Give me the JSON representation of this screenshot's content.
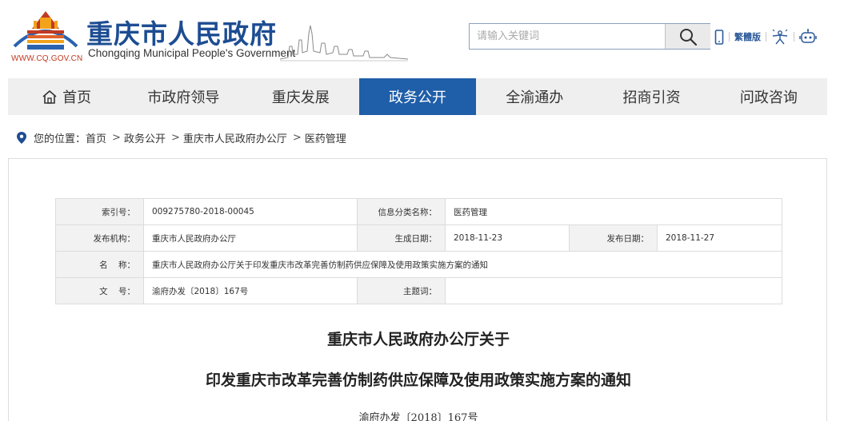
{
  "header": {
    "site_title": "重庆市人民政府",
    "site_subtitle": "Chongqing Municipal People's Government",
    "logo_url_text": "WWW.CQ.GOV.CN",
    "search": {
      "placeholder": "请输入关键词",
      "value": ""
    },
    "tools": {
      "mobile_icon": "mobile-icon",
      "traditional_label": "繁體版",
      "accessibility_icon": "accessibility-icon",
      "robot_icon": "robot-icon"
    }
  },
  "nav": {
    "items": [
      {
        "label": "首页",
        "icon": "home-icon",
        "active": false
      },
      {
        "label": "市政府领导",
        "active": false
      },
      {
        "label": "重庆发展",
        "active": false
      },
      {
        "label": "政务公开",
        "active": true
      },
      {
        "label": "全渝通办",
        "active": false
      },
      {
        "label": "招商引资",
        "active": false
      },
      {
        "label": "问政咨询",
        "active": false
      }
    ]
  },
  "breadcrumb": {
    "prefix": "您的位置：",
    "items": [
      "首页",
      "政务公开",
      "重庆市人民政府办公厅",
      "医药管理"
    ],
    "separator": ">"
  },
  "meta": {
    "index_no_label": "索引号：",
    "index_no": "009275780-2018-00045",
    "category_label": "信息分类名称：",
    "category": "医药管理",
    "publisher_label": "发布机构：",
    "publisher": "重庆市人民政府办公厅",
    "created_label": "生成日期：",
    "created": "2018-11-23",
    "published_label": "发布日期：",
    "published": "2018-11-27",
    "name_label": "名    称：",
    "name": "重庆市人民政府办公厅关于印发重庆市改革完善仿制药供应保障及使用政策实施方案的通知",
    "doc_no_label": "文    号：",
    "doc_no": "渝府办发〔2018〕167号",
    "subject_label": "主题词：",
    "subject": ""
  },
  "document": {
    "title_line1": "重庆市人民政府办公厅关于",
    "title_line2": "印发重庆市改革完善仿制药供应保障及使用政策实施方案的通知",
    "doc_number": "渝府办发〔2018〕167号"
  },
  "colors": {
    "brand_blue": "#1d4d92",
    "nav_active": "#1f5ea8",
    "logo_red": "#c23a22",
    "logo_yellow": "#f2a31b"
  }
}
